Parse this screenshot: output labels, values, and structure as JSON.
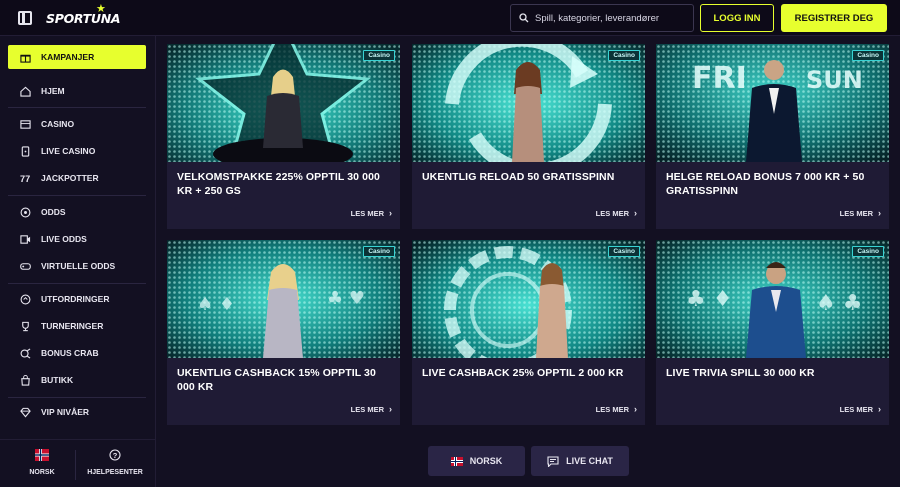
{
  "header": {
    "logo_text": "SPORTUNA",
    "search_placeholder": "Spill, kategorier, leverandører",
    "login_label": "LOGG INN",
    "register_label": "REGISTRER DEG"
  },
  "sidebar": {
    "items": [
      {
        "label": "KAMPANJER",
        "icon": "gift-icon"
      },
      {
        "label": "HJEM",
        "icon": "home-icon"
      },
      {
        "label": "CASINO",
        "icon": "casino-icon"
      },
      {
        "label": "LIVE CASINO",
        "icon": "live-casino-icon"
      },
      {
        "label": "JACKPOTTER",
        "icon": "jackpot-icon"
      },
      {
        "label": "ODDS",
        "icon": "ball-icon"
      },
      {
        "label": "LIVE ODDS",
        "icon": "live-odds-icon"
      },
      {
        "label": "VIRTUELLE ODDS",
        "icon": "gamepad-icon"
      },
      {
        "label": "UTFORDRINGER",
        "icon": "challenge-icon"
      },
      {
        "label": "TURNERINGER",
        "icon": "trophy-icon"
      },
      {
        "label": "BONUS CRAB",
        "icon": "crab-icon"
      },
      {
        "label": "BUTIKK",
        "icon": "shop-icon"
      },
      {
        "label": "VIP NIVÅER",
        "icon": "diamond-icon"
      }
    ],
    "footer": {
      "language_label": "NORSK",
      "help_label": "HJELPESENTER"
    }
  },
  "promotions": [
    {
      "badge": "Casino",
      "title": "VELKOMSTPAKKE 225% OPPTIL 30 000 KR + 250 GS",
      "link": "LES MER",
      "art": "star"
    },
    {
      "badge": "Casino",
      "title": "UKENTLIG RELOAD 50 GRATISSPINN",
      "link": "LES MER",
      "art": "reload"
    },
    {
      "badge": "Casino",
      "title": "HELGE RELOAD BONUS 7 000 KR + 50 GRATISSPINN",
      "link": "LES MER",
      "art": "frisun"
    },
    {
      "badge": "Casino",
      "title": "UKENTLIG CASHBACK 15% OPPTIL 30 000 KR",
      "link": "LES MER",
      "art": "cards"
    },
    {
      "badge": "Casino",
      "title": "LIVE CASHBACK 25% OPPTIL 2 000 KR",
      "link": "LES MER",
      "art": "chip"
    },
    {
      "badge": "Casino",
      "title": "LIVE TRIVIA SPILL 30 000 KR",
      "link": "LES MER",
      "art": "trivia"
    }
  ],
  "bottom": {
    "language_button": "NORSK",
    "chat_button": "LIVE CHAT"
  },
  "colors": {
    "accent": "#e7ff2e",
    "background": "#131022",
    "card": "#1f1b35",
    "teal": "#2fd6c8"
  }
}
